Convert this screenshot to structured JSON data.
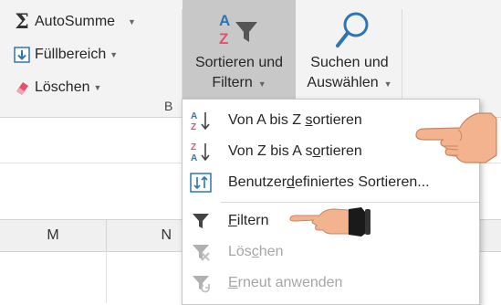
{
  "ribbon": {
    "autosum": {
      "label": "AutoSumme",
      "icon": "sigma-icon"
    },
    "fill": {
      "label": "Füllbereich",
      "icon": "fill-down-icon"
    },
    "clear": {
      "label": "Löschen",
      "icon": "eraser-icon"
    },
    "sort_filter": {
      "label_line1": "Sortieren und",
      "label_line2": "Filtern",
      "icon": "sort-filter-icon"
    },
    "find_select": {
      "label_line1": "Suchen und",
      "label_line2": "Auswählen",
      "icon": "magnifier-icon"
    },
    "group_label_fragment": "B"
  },
  "columns": [
    "M",
    "N"
  ],
  "menu": {
    "items": [
      {
        "pre": "Von A bis Z ",
        "u": "s",
        "post": "ortieren",
        "icon": "sort-a-z-icon",
        "disabled": false
      },
      {
        "pre": "Von Z bis A s",
        "u": "o",
        "post": "rtieren",
        "icon": "sort-z-a-icon",
        "disabled": false
      },
      {
        "pre": "Benutzer",
        "u": "d",
        "post": "efiniertes Sortieren...",
        "icon": "custom-sort-icon",
        "disabled": false
      },
      {
        "pre": "",
        "u": "F",
        "post": "iltern",
        "icon": "filter-icon",
        "disabled": false
      },
      {
        "pre": "Lös",
        "u": "c",
        "post": "hen",
        "icon": "clear-filter-icon",
        "disabled": true
      },
      {
        "pre": "",
        "u": "E",
        "post": "rneut anwenden",
        "icon": "reapply-filter-icon",
        "disabled": true
      }
    ]
  },
  "colors": {
    "ribbon_bg": "#f3f3f3",
    "active_button_bg": "#c8c8c8",
    "sort_blue": "#2e75b6",
    "eraser_pink": "#e8506a"
  }
}
